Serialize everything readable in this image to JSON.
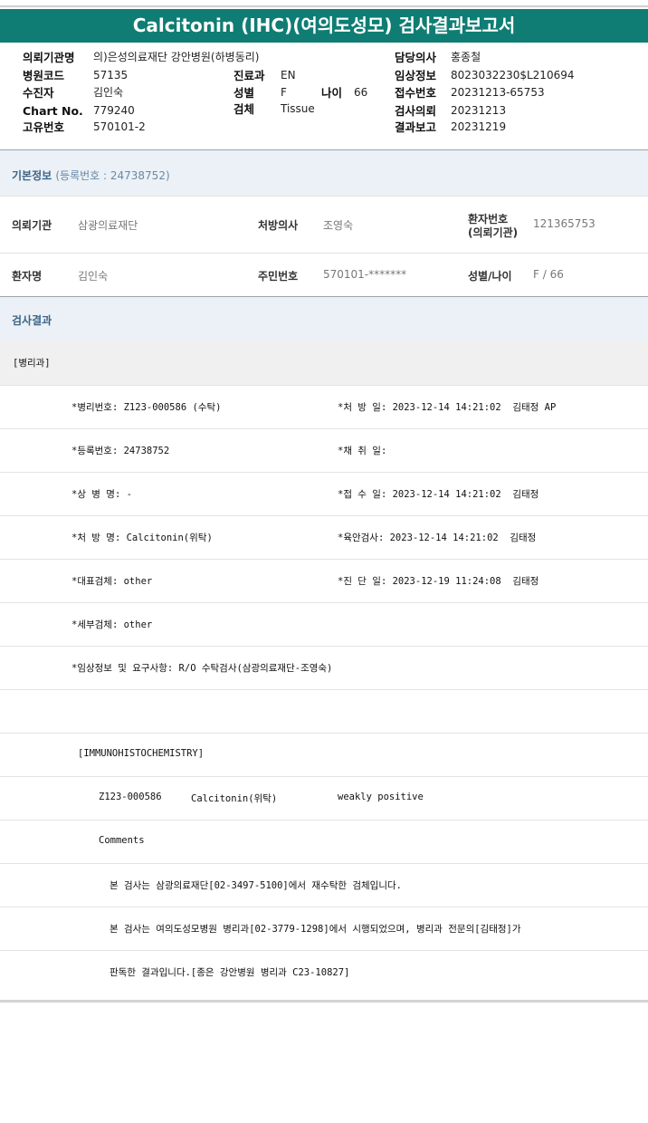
{
  "title": "Calcitonin (IHC)(여의도성모) 검사결과보고서",
  "header": {
    "request_org_label": "의뢰기관명",
    "request_org_value": "의)은성의료재단 강안병원(하병동리)",
    "hospital_code_label": "병원코드",
    "hospital_code_value": "57135",
    "dept_label": "진료과",
    "dept_value": "EN",
    "patient_label": "수진자",
    "patient_value": "김인숙",
    "sex_label": "성별",
    "sex_value": "F",
    "age_label": "나이",
    "age_value": "66",
    "chart_label": "Chart No.",
    "chart_value": "779240",
    "specimen_label": "검체",
    "specimen_value": "Tissue",
    "unique_label": "고유번호",
    "unique_value": "570101-2",
    "doctor_label": "담당의사",
    "doctor_value": "홍종철",
    "clinical_label": "임상정보",
    "clinical_value": "8023032230$L210694",
    "receipt_label": "접수번호",
    "receipt_value": "20231213-65753",
    "request_date_label": "검사의뢰",
    "request_date_value": "20231213",
    "report_date_label": "결과보고",
    "report_date_value": "20231219"
  },
  "basic_info": {
    "title": "기본정보",
    "subtitle": "(등록번호 : 24738752)",
    "org_label": "의뢰기관",
    "org_value": "삼광의료재단",
    "doctor_label": "처방의사",
    "doctor_value": "조영숙",
    "patno_label_1": "환자번호",
    "patno_label_2": "(의뢰기관)",
    "patno_value": "121365753",
    "name_label": "환자명",
    "name_value": "김인숙",
    "ssn_label": "주민번호",
    "ssn_value": "570101-*******",
    "sexage_label": "성별/나이",
    "sexage_value": "F / 66"
  },
  "results": {
    "title": "검사결과",
    "dept": "[병리과]",
    "rows": [
      {
        "left": "*병리번호: Z123-000586 (수탁)",
        "right": "*처 방 일: 2023-12-14 14:21:02  김태정 AP"
      },
      {
        "left": "*등록번호: 24738752",
        "right": "*채 취 일:"
      },
      {
        "left": "*상 병 명: -",
        "right": "*접 수 일: 2023-12-14 14:21:02  김태정"
      },
      {
        "left": "*처 방 명: Calcitonin(위탁)",
        "right": "*육안검사: 2023-12-14 14:21:02  김태정"
      },
      {
        "left": "*대표검체: other",
        "right": "*진 단 일: 2023-12-19 11:24:08  김태정"
      },
      {
        "left": "*세부검체: other",
        "right": ""
      },
      {
        "left": "*임상정보 및 요구사항: R/O 수탁검사(삼광의료재단-조영숙)",
        "right": ""
      }
    ],
    "ihc_header": "[IMMUNOHISTOCHEMISTRY]",
    "ihc_no": "Z123-000586",
    "ihc_test": "Calcitonin(위탁)",
    "ihc_result": "weakly positive",
    "comments_label": "Comments",
    "comment_1": "본 검사는 삼광의료재단[02-3497-5100]에서 재수탁한 검체입니다.",
    "comment_2": "본 검사는 여의도성모병원 병리과[02-3779-1298]에서 시행되었으며, 병리과 전문의[김태정]가",
    "comment_3": "판독한 결과입니다.[종은 강안병원 병리과 C23-10827]"
  }
}
